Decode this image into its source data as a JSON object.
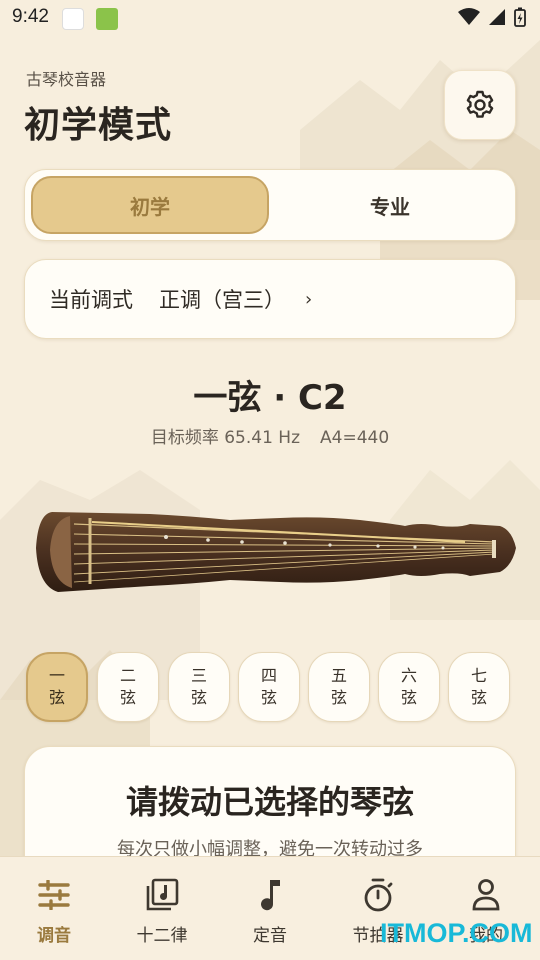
{
  "status_bar": {
    "time": "9:42"
  },
  "header": {
    "app_name": "古琴校音器",
    "title": "初学模式"
  },
  "mode_toggle": {
    "beginner_label": "初学",
    "pro_label": "专业",
    "selected": "初学"
  },
  "tuning": {
    "label": "当前调式",
    "value": "正调（宫三）",
    "chevron": "›"
  },
  "current_string": {
    "heading": "一弦 · C2",
    "target_label": "目标频率 65.41 Hz",
    "reference": "A4=440"
  },
  "strings": [
    {
      "top": "一",
      "bottom": "弦",
      "active": true
    },
    {
      "top": "二",
      "bottom": "弦",
      "active": false
    },
    {
      "top": "三",
      "bottom": "弦",
      "active": false
    },
    {
      "top": "四",
      "bottom": "弦",
      "active": false
    },
    {
      "top": "五",
      "bottom": "弦",
      "active": false
    },
    {
      "top": "六",
      "bottom": "弦",
      "active": false
    },
    {
      "top": "七",
      "bottom": "弦",
      "active": false
    }
  ],
  "instruction": {
    "title": "请拨动已选择的琴弦",
    "hint": "每次只做小幅调整，避免一次转动过多"
  },
  "bottom_nav": [
    {
      "label": "调音",
      "icon": "sliders-icon",
      "active": true
    },
    {
      "label": "十二律",
      "icon": "music-library-icon",
      "active": false
    },
    {
      "label": "定音",
      "icon": "music-note-icon",
      "active": false
    },
    {
      "label": "节拍器",
      "icon": "stopwatch-icon",
      "active": false
    },
    {
      "label": "我的",
      "icon": "person-icon",
      "active": false
    }
  ],
  "watermark": "ITMOP.COM",
  "colors": {
    "background": "#f7eedd",
    "accent": "#e5c98d",
    "accent_border": "#c6a464",
    "accent_text": "#9a7a3e",
    "watermark": "#18b9d8"
  }
}
